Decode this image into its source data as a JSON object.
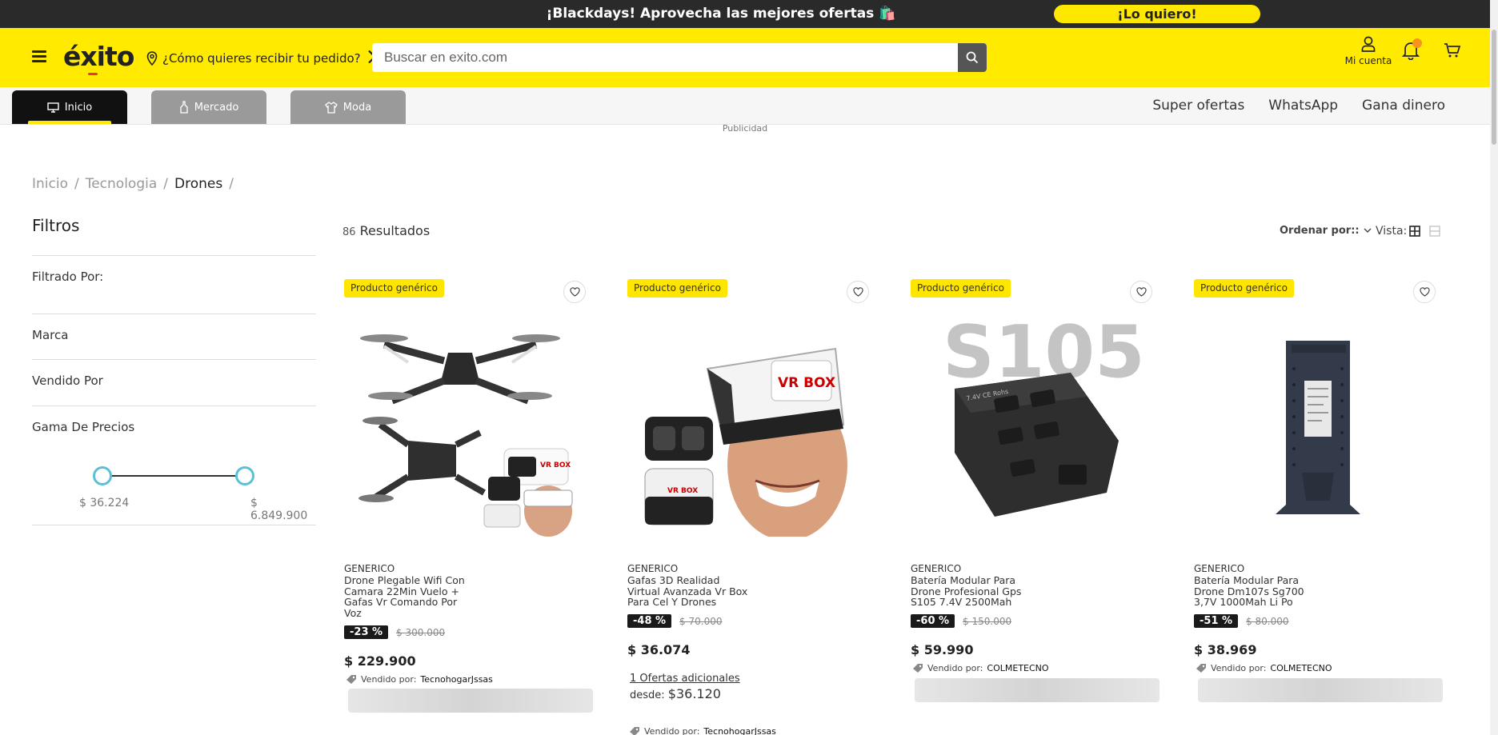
{
  "promo": {
    "text": "¡Blackdays! Aprovecha las mejores ofertas 🛍️",
    "cta": "¡Lo quiero!"
  },
  "header": {
    "logo": "éxito",
    "delivery": "¿Cómo quieres recibir tu pedido?",
    "search_placeholder": "Buscar en exito.com",
    "account": "Mi cuenta"
  },
  "nav": {
    "tabs": [
      {
        "label": "Inicio",
        "icon": "monitor-icon"
      },
      {
        "label": "Mercado",
        "icon": "bottle-icon"
      },
      {
        "label": "Moda",
        "icon": "shirt-icon"
      }
    ],
    "links": [
      "Super ofertas",
      "WhatsApp",
      "Gana dinero"
    ]
  },
  "ad_label": "Publicidad",
  "breadcrumb": [
    "Inicio",
    "Tecnologia",
    "Drones"
  ],
  "filters": {
    "title": "Filtros",
    "filtered_by": "Filtrado Por:",
    "marca": "Marca",
    "vendido": "Vendido Por",
    "gama": "Gama De Precios",
    "price_min": "$ 36.224",
    "price_max": "$ 6.849.900"
  },
  "results": {
    "count": "86",
    "label": "Resultados",
    "sort": "Ordenar por::",
    "vista": "Vista:"
  },
  "products": [
    {
      "badge": "Producto genérico",
      "brand": "GENERICO",
      "name": "Drone Plegable Wifi Con Camara 22Min Vuelo + Gafas Vr Comando Por Voz",
      "discount": "-23 %",
      "old_price": "$ 300.000",
      "price": "$ 229.900",
      "seller_label": "Vendido por:",
      "seller": "TecnohogarJssas"
    },
    {
      "badge": "Producto genérico",
      "brand": "GENERICO",
      "name": "Gafas 3D Realidad Virtual Avanzada Vr Box Para Cel Y Drones",
      "discount": "-48 %",
      "old_price": "$ 70.000",
      "price": "$ 36.074",
      "offers": "1 Ofertas adicionales",
      "desde_label": "desde:",
      "desde_price": "$36.120",
      "seller_label": "Vendido por:",
      "seller": "TecnohogarJssas"
    },
    {
      "badge": "Producto genérico",
      "brand": "GENERICO",
      "name": "Batería Modular Para Drone Profesional Gps S105 7.4V 2500Mah",
      "image_text": "S105",
      "discount": "-60 %",
      "old_price": "$ 150.000",
      "price": "$ 59.990",
      "seller_label": "Vendido por:",
      "seller": "COLMETECNO"
    },
    {
      "badge": "Producto genérico",
      "brand": "GENERICO",
      "name": "Batería Modular Para Drone Dm107s Sg700 3,7V 1000Mah Li Po",
      "discount": "-51 %",
      "old_price": "$ 80.000",
      "price": "$ 38.969",
      "seller_label": "Vendido por:",
      "seller": "COLMETECNO"
    }
  ],
  "colors": {
    "brand_yellow": "#ffea00",
    "dark": "#2a2a2a",
    "slider": "#5bbfd6"
  }
}
